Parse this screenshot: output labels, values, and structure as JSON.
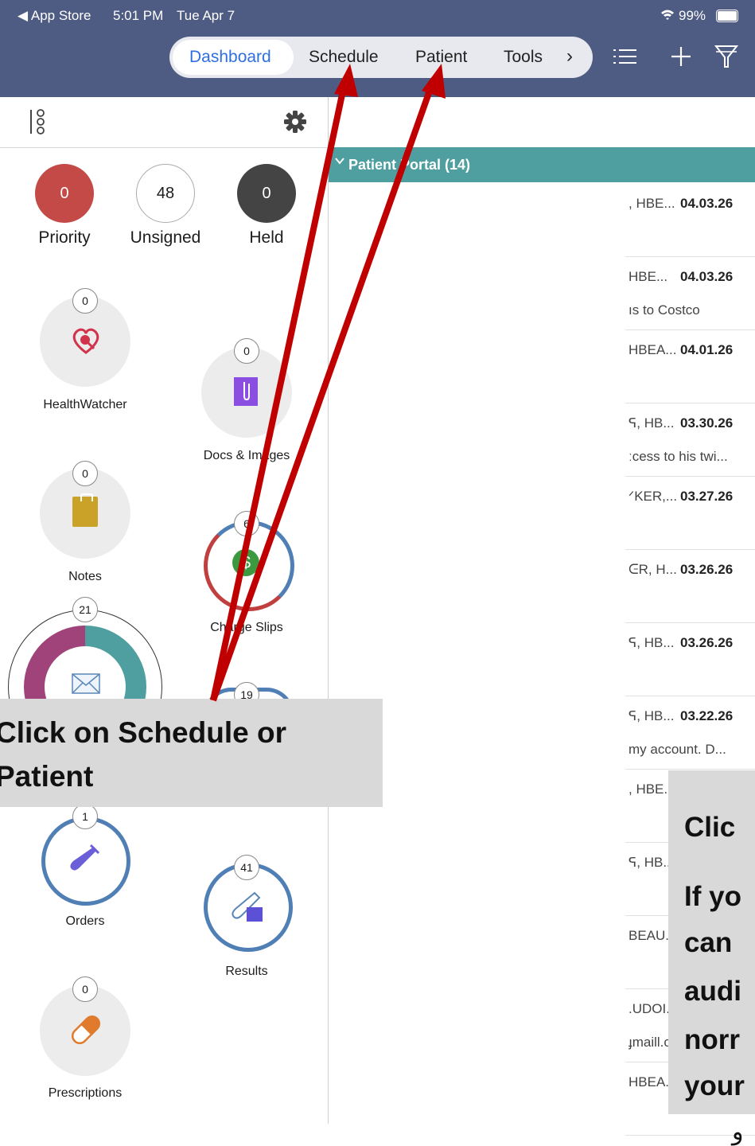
{
  "status_bar": {
    "back": "◀ App Store",
    "time": "5:01 PM",
    "date": "Tue Apr 7",
    "battery": "99%"
  },
  "nav": {
    "tabs": [
      "Dashboard",
      "Schedule",
      "Patient",
      "Tools"
    ],
    "active_tab": "Dashboard",
    "more_icon": "chevron-right-icon",
    "icons": [
      "list-icon",
      "plus-icon",
      "filter-icon"
    ]
  },
  "sidebar": {
    "counters": [
      {
        "label": "Priority",
        "value": "0",
        "color": "#c44a47"
      },
      {
        "label": "Unsigned",
        "value": "48",
        "color": "#ffffff"
      },
      {
        "label": "Held",
        "value": "0",
        "color": "#444444"
      }
    ],
    "tiles": [
      {
        "label": "HealthWatcher",
        "count": "0",
        "icon": "heart-icon"
      },
      {
        "label": "Docs & Images",
        "count": "0",
        "icon": "paperclip-icon"
      },
      {
        "label": "Notes",
        "count": "0",
        "icon": "clipboard-icon"
      },
      {
        "label": "Charge Slips",
        "count": "6",
        "icon": "dollar-icon"
      },
      {
        "label": "",
        "count": "21",
        "icon": "envelope-icon"
      },
      {
        "label": "",
        "count": "19",
        "icon": ""
      },
      {
        "label": "Orders",
        "count": "1",
        "icon": "test-tube-icon"
      },
      {
        "label": "Results",
        "count": "41",
        "icon": "flask-icon"
      },
      {
        "label": "Prescriptions",
        "count": "0",
        "icon": "pill-icon"
      }
    ]
  },
  "portal": {
    "header": "Patient Portal (14)",
    "rows": [
      {
        "name": ", HBE...",
        "date": "04.03.26",
        "sub": ""
      },
      {
        "name": "HBE...",
        "date": "04.03.26",
        "sub": "ıs to Costco"
      },
      {
        "name": "HBEA...",
        "date": "04.01.26",
        "sub": ""
      },
      {
        "name": "ᕋ, HB...",
        "date": "03.30.26",
        "sub": "ːcess to his twi..."
      },
      {
        "name": "ᐟKER,...",
        "date": "03.27.26",
        "sub": ""
      },
      {
        "name": "ᕮR, H...",
        "date": "03.26.26",
        "sub": ""
      },
      {
        "name": "ᕋ, HB...",
        "date": "03.26.26",
        "sub": ""
      },
      {
        "name": "ᕋ, HB...",
        "date": "03.22.26",
        "sub": "my account. D..."
      },
      {
        "name": ", HBE..",
        "date": "",
        "sub": ""
      },
      {
        "name": "ᕋ, HB..",
        "date": "",
        "sub": ""
      },
      {
        "name": "BEAU..",
        "date": "",
        "sub": ""
      },
      {
        "name": ".UDOI.",
        "date": "",
        "sub": "ɟmaill.c"
      },
      {
        "name": "HBEA..",
        "date": "",
        "sub": ""
      }
    ]
  },
  "callouts": {
    "primary": [
      "Click on Schedule or",
      "Patient"
    ],
    "secondary": [
      "Clic",
      "",
      "If yo",
      "can",
      "audi",
      "norr",
      "your"
    ]
  },
  "colors": {
    "nav": "#4e5b82",
    "portal": "#4f9ea0",
    "arrow": "#c00000",
    "callout": "#d9d9d9"
  }
}
